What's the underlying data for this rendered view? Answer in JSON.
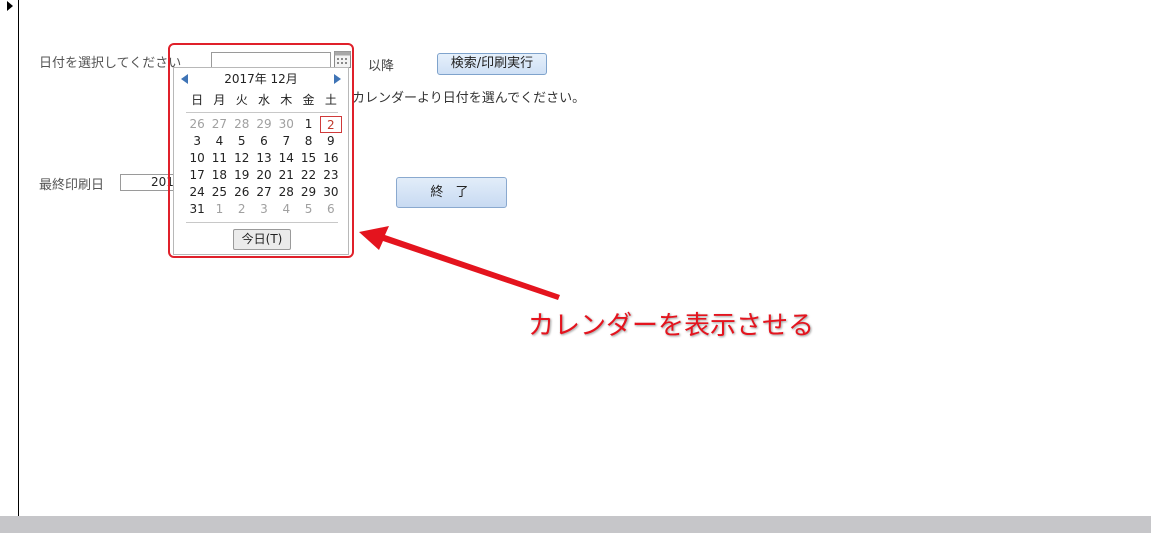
{
  "form": {
    "date_label": "日付を選択してください",
    "date_value": "",
    "after_label": "以降",
    "search_button": "検索/印刷実行",
    "hint": "カレンダーより日付を選んでください。",
    "last_print_label": "最終印刷日",
    "last_print_value": "201",
    "exit_button": "終 了"
  },
  "calendar": {
    "title": "2017年 12月",
    "weekdays": [
      "日",
      "月",
      "火",
      "水",
      "木",
      "金",
      "土"
    ],
    "weeks": [
      [
        "26",
        "27",
        "28",
        "29",
        "30",
        "1",
        "2"
      ],
      [
        "3",
        "4",
        "5",
        "6",
        "7",
        "8",
        "9"
      ],
      [
        "10",
        "11",
        "12",
        "13",
        "14",
        "15",
        "16"
      ],
      [
        "17",
        "18",
        "19",
        "20",
        "21",
        "22",
        "23"
      ],
      [
        "24",
        "25",
        "26",
        "27",
        "28",
        "29",
        "30"
      ],
      [
        "31",
        "1",
        "2",
        "3",
        "4",
        "5",
        "6"
      ]
    ],
    "muted": [
      [
        true,
        true,
        true,
        true,
        true,
        false,
        false
      ],
      [
        false,
        false,
        false,
        false,
        false,
        false,
        false
      ],
      [
        false,
        false,
        false,
        false,
        false,
        false,
        false
      ],
      [
        false,
        false,
        false,
        false,
        false,
        false,
        false
      ],
      [
        false,
        false,
        false,
        false,
        false,
        false,
        false
      ],
      [
        false,
        true,
        true,
        true,
        true,
        true,
        true
      ]
    ],
    "selected": "2",
    "today_button": "今日(T)"
  },
  "annotation": {
    "text": "カレンダーを表示させる",
    "color": "#e4141e"
  }
}
